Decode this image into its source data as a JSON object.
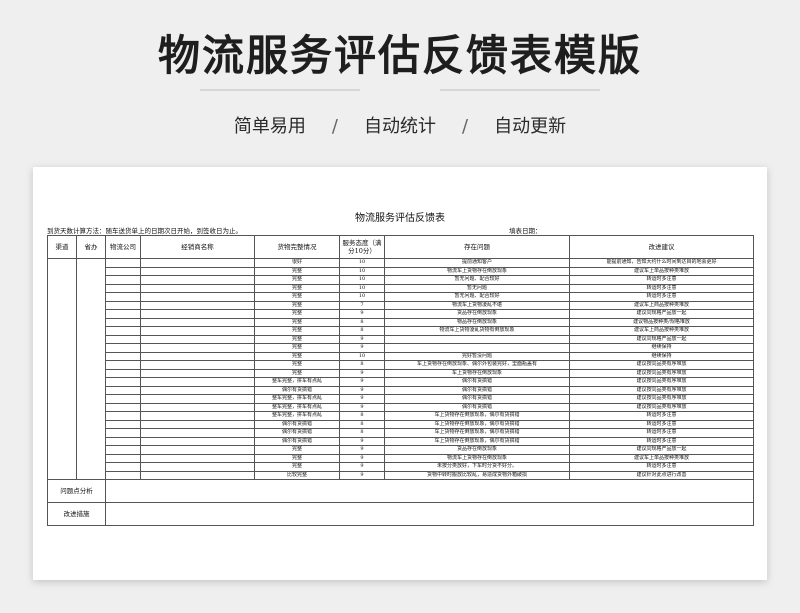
{
  "header": {
    "title": "物流服务评估反馈表模版",
    "subtitle_items": [
      "简单易用",
      "自动统计",
      "自动更新"
    ],
    "subtitle_separator": "/"
  },
  "sheet": {
    "title": "物流服务评估反馈表",
    "note": "到货天数计算方法：随车送货单上的日期次日开始，到签收日为止。",
    "date_label": "填表日期：",
    "columns": [
      "渠道",
      "省办",
      "物流公司",
      "经销商名称",
      "货物完整情况",
      "服务态度（满分10分）",
      "存在问题",
      "改进建议"
    ],
    "rows": [
      {
        "condition": "很好",
        "score": "10",
        "issue": "提前通知客户",
        "suggestion": "能提前通知，告知大约什么时间到达目的地会更好"
      },
      {
        "condition": "完整",
        "score": "10",
        "issue": "物流车上货物存在倒放现象",
        "suggestion": "建议车上单品按种类堆放"
      },
      {
        "condition": "完整",
        "score": "10",
        "issue": "暂无问题、配合较好",
        "suggestion": "转运时多注意"
      },
      {
        "condition": "完整",
        "score": "10",
        "issue": "暂无问题",
        "suggestion": "转运时多注意"
      },
      {
        "condition": "完整",
        "score": "10",
        "issue": "暂无问题、配合较好",
        "suggestion": "转运时多注意"
      },
      {
        "condition": "完整",
        "score": "7",
        "issue": "物流车上货物凌乱不堪",
        "suggestion": "建议车上商品按种类堆放"
      },
      {
        "condition": "完整",
        "score": "9",
        "issue": "货品存在倒放现象",
        "suggestion": "建议同规格产品放一起"
      },
      {
        "condition": "完整",
        "score": "8",
        "issue": "物品存在倒放现象",
        "suggestion": "建议物品按种类/规格堆放"
      },
      {
        "condition": "完整",
        "score": "8",
        "issue": "物流车上货物凌乱货物有倒放现象",
        "suggestion": "建议车上商品按种类堆放"
      },
      {
        "condition": "完整",
        "score": "9",
        "issue": "",
        "suggestion": "建议同规格产品放一起"
      },
      {
        "condition": "完整",
        "score": "9",
        "issue": "",
        "suggestion": "继续保持"
      },
      {
        "condition": "完整",
        "score": "10",
        "issue": "完好暂没问题",
        "suggestion": "继续保持"
      },
      {
        "condition": "完整",
        "score": "8",
        "issue": "车上货物存在倒放现象、偶尔外包装完好，里面瓶盖有",
        "suggestion": "建议按同品类有序堆放"
      },
      {
        "condition": "完整",
        "score": "9",
        "issue": "车上货物存在倒放现象",
        "suggestion": "建议按同品类有序堆放"
      },
      {
        "condition": "整车完整，拼车有点乱",
        "score": "9",
        "issue": "偶尔有货搞错",
        "suggestion": "建议按同品类有序堆放"
      },
      {
        "condition": "偶尔有货搞错",
        "score": "9",
        "issue": "偶尔有货搞错",
        "suggestion": "建议按同品类有序堆放"
      },
      {
        "condition": "整车完整，拼车有点乱",
        "score": "9",
        "issue": "偶尔有货搞错",
        "suggestion": "建议按同品类有序堆放"
      },
      {
        "condition": "整车完整，拼车有点乱",
        "score": "9",
        "issue": "偶尔有货搞错",
        "suggestion": "建议按同品类有序堆放"
      },
      {
        "condition": "整车完整，拼车有点乱",
        "score": "8",
        "issue": "车上货物存在倒放现象，偶尔有货搞错",
        "suggestion": "转运时多注意"
      },
      {
        "condition": "偶尔有货搞错",
        "score": "8",
        "issue": "车上货物存在倒放现象，偶尔有货搞错",
        "suggestion": "转运时多注意"
      },
      {
        "condition": "偶尔有货搞错",
        "score": "8",
        "issue": "车上货物存在倒放现象，偶尔有货搞错",
        "suggestion": "转运时多注意"
      },
      {
        "condition": "偶尔有货搞错",
        "score": "9",
        "issue": "车上货物存在倒放现象，偶尔有货搞错",
        "suggestion": "转运时多注意"
      },
      {
        "condition": "完整",
        "score": "9",
        "issue": "货品存在倒放现象",
        "suggestion": "建议同规格产品放一起"
      },
      {
        "condition": "完整",
        "score": "9",
        "issue": "物流车上货物存在倒放现象",
        "suggestion": "建议车上单品按种类堆放"
      },
      {
        "condition": "完整",
        "score": "9",
        "issue": "未按分类放好，下车时分货不好分。",
        "suggestion": "转运时多注意"
      },
      {
        "condition": "比较完整",
        "score": "9",
        "issue": "货物中转时搬放比较乱，易造成货物外箱破损",
        "suggestion": "建议针对此点进行改善"
      }
    ],
    "footer_rows": [
      "问题点分析",
      "改进措施"
    ]
  }
}
